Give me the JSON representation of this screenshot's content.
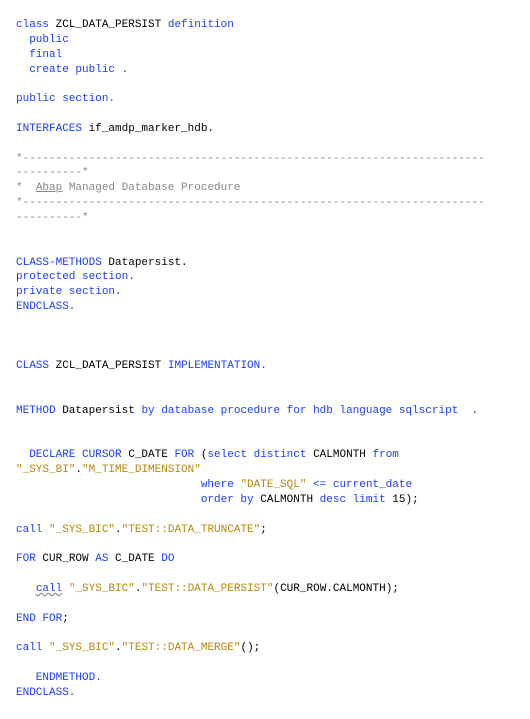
{
  "code": {
    "l1_kw1": "class",
    "l1_id": " ZCL_DATA_PERSIST ",
    "l1_kw2": "definition",
    "l2": "  public",
    "l3": "  final",
    "l4": "  create public .",
    "l5_kw": "public section.",
    "l6_kw": "INTERFACES",
    "l6_id": " if_amdp_marker_hdb.",
    "c1": "*----------------------------------------------------------------------",
    "c1b": "----------*",
    "c2a": "*  ",
    "c2u": "Abap",
    "c2b": " Managed Database Procedure",
    "c3": "*----------------------------------------------------------------------",
    "c3b": "----------*",
    "l7_kw": "CLASS-METHODS",
    "l7_id": " Datapersist.",
    "l8": "protected section.",
    "l9": "private section.",
    "l10": "ENDCLASS.",
    "l11_kw1": "CLASS",
    "l11_id": " ZCL_DATA_PERSIST ",
    "l11_kw2": "IMPLEMENTATION.",
    "l12_kw1": "METHOD",
    "l12_id": " Datapersist ",
    "l12_kw2": "by database procedure for hdb language sqlscript  .",
    "l13a": "  DECLARE CURSOR",
    "l13b": " C_DATE ",
    "l13c": "FOR",
    "l13d": " (",
    "l13e": "select distinct",
    "l13f": " CALMONTH ",
    "l13g": "from",
    "l14a": "\"_SYS_BI\"",
    "l14b": ".",
    "l14c": "\"M_TIME_DIMENSION\"",
    "l15a": "                            where ",
    "l15b": "\"DATE_SQL\"",
    "l15c": " <= current_date",
    "l16a": "                            order by",
    "l16b": " CALMONTH ",
    "l16c": "desc limit",
    "l16d": " 15);",
    "l17a": "call",
    "l17b": " ",
    "l17c": "\"_SYS_BIC\"",
    "l17d": ".",
    "l17e": "\"TEST::DATA_TRUNCATE\"",
    "l17f": ";",
    "l18a": "FOR",
    "l18b": " CUR_ROW ",
    "l18c": "AS",
    "l18d": " C_DATE ",
    "l18e": "DO",
    "l19a": "   ",
    "l19b": "call",
    "l19c": " ",
    "l19d": "\"_SYS_BIC\"",
    "l19e": ".",
    "l19f": "\"TEST::DATA_PERSIST\"",
    "l19g": "(CUR_ROW.CALMONTH);",
    "l20": "END FOR",
    "l20b": ";",
    "l21a": "call",
    "l21b": " ",
    "l21c": "\"_SYS_BIC\"",
    "l21d": ".",
    "l21e": "\"TEST::DATA_MERGE\"",
    "l21f": "();",
    "l22": "   ENDMETHOD.",
    "l23": "ENDCLASS."
  }
}
